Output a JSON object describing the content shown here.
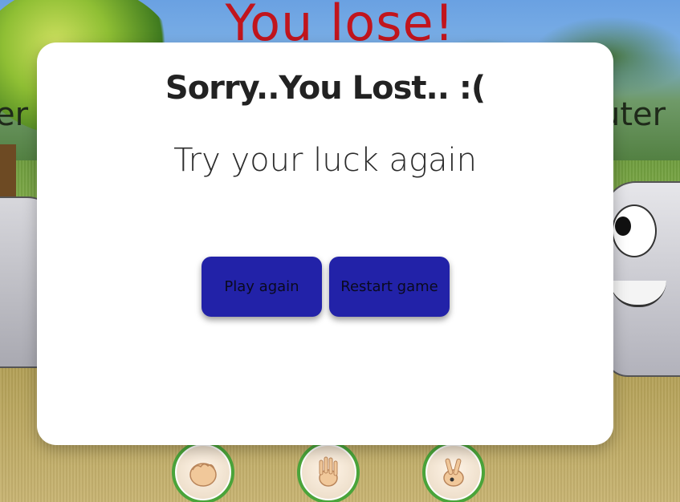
{
  "game": {
    "result_banner": "You lose!",
    "player_label": "er",
    "computer_label": "uter"
  },
  "modal": {
    "title": "Sorry..You Lost.. :(",
    "subtitle": "Try your luck again",
    "play_again_label": "Play again",
    "restart_label": "Restart game"
  },
  "choices": {
    "rock_icon": "rock-hand-icon",
    "paper_icon": "paper-hand-icon",
    "scissors_icon": "scissors-hand-icon"
  },
  "colors": {
    "banner": "#c1151d",
    "button_bg": "#2222a8",
    "choice_ring": "#4aa43a"
  }
}
